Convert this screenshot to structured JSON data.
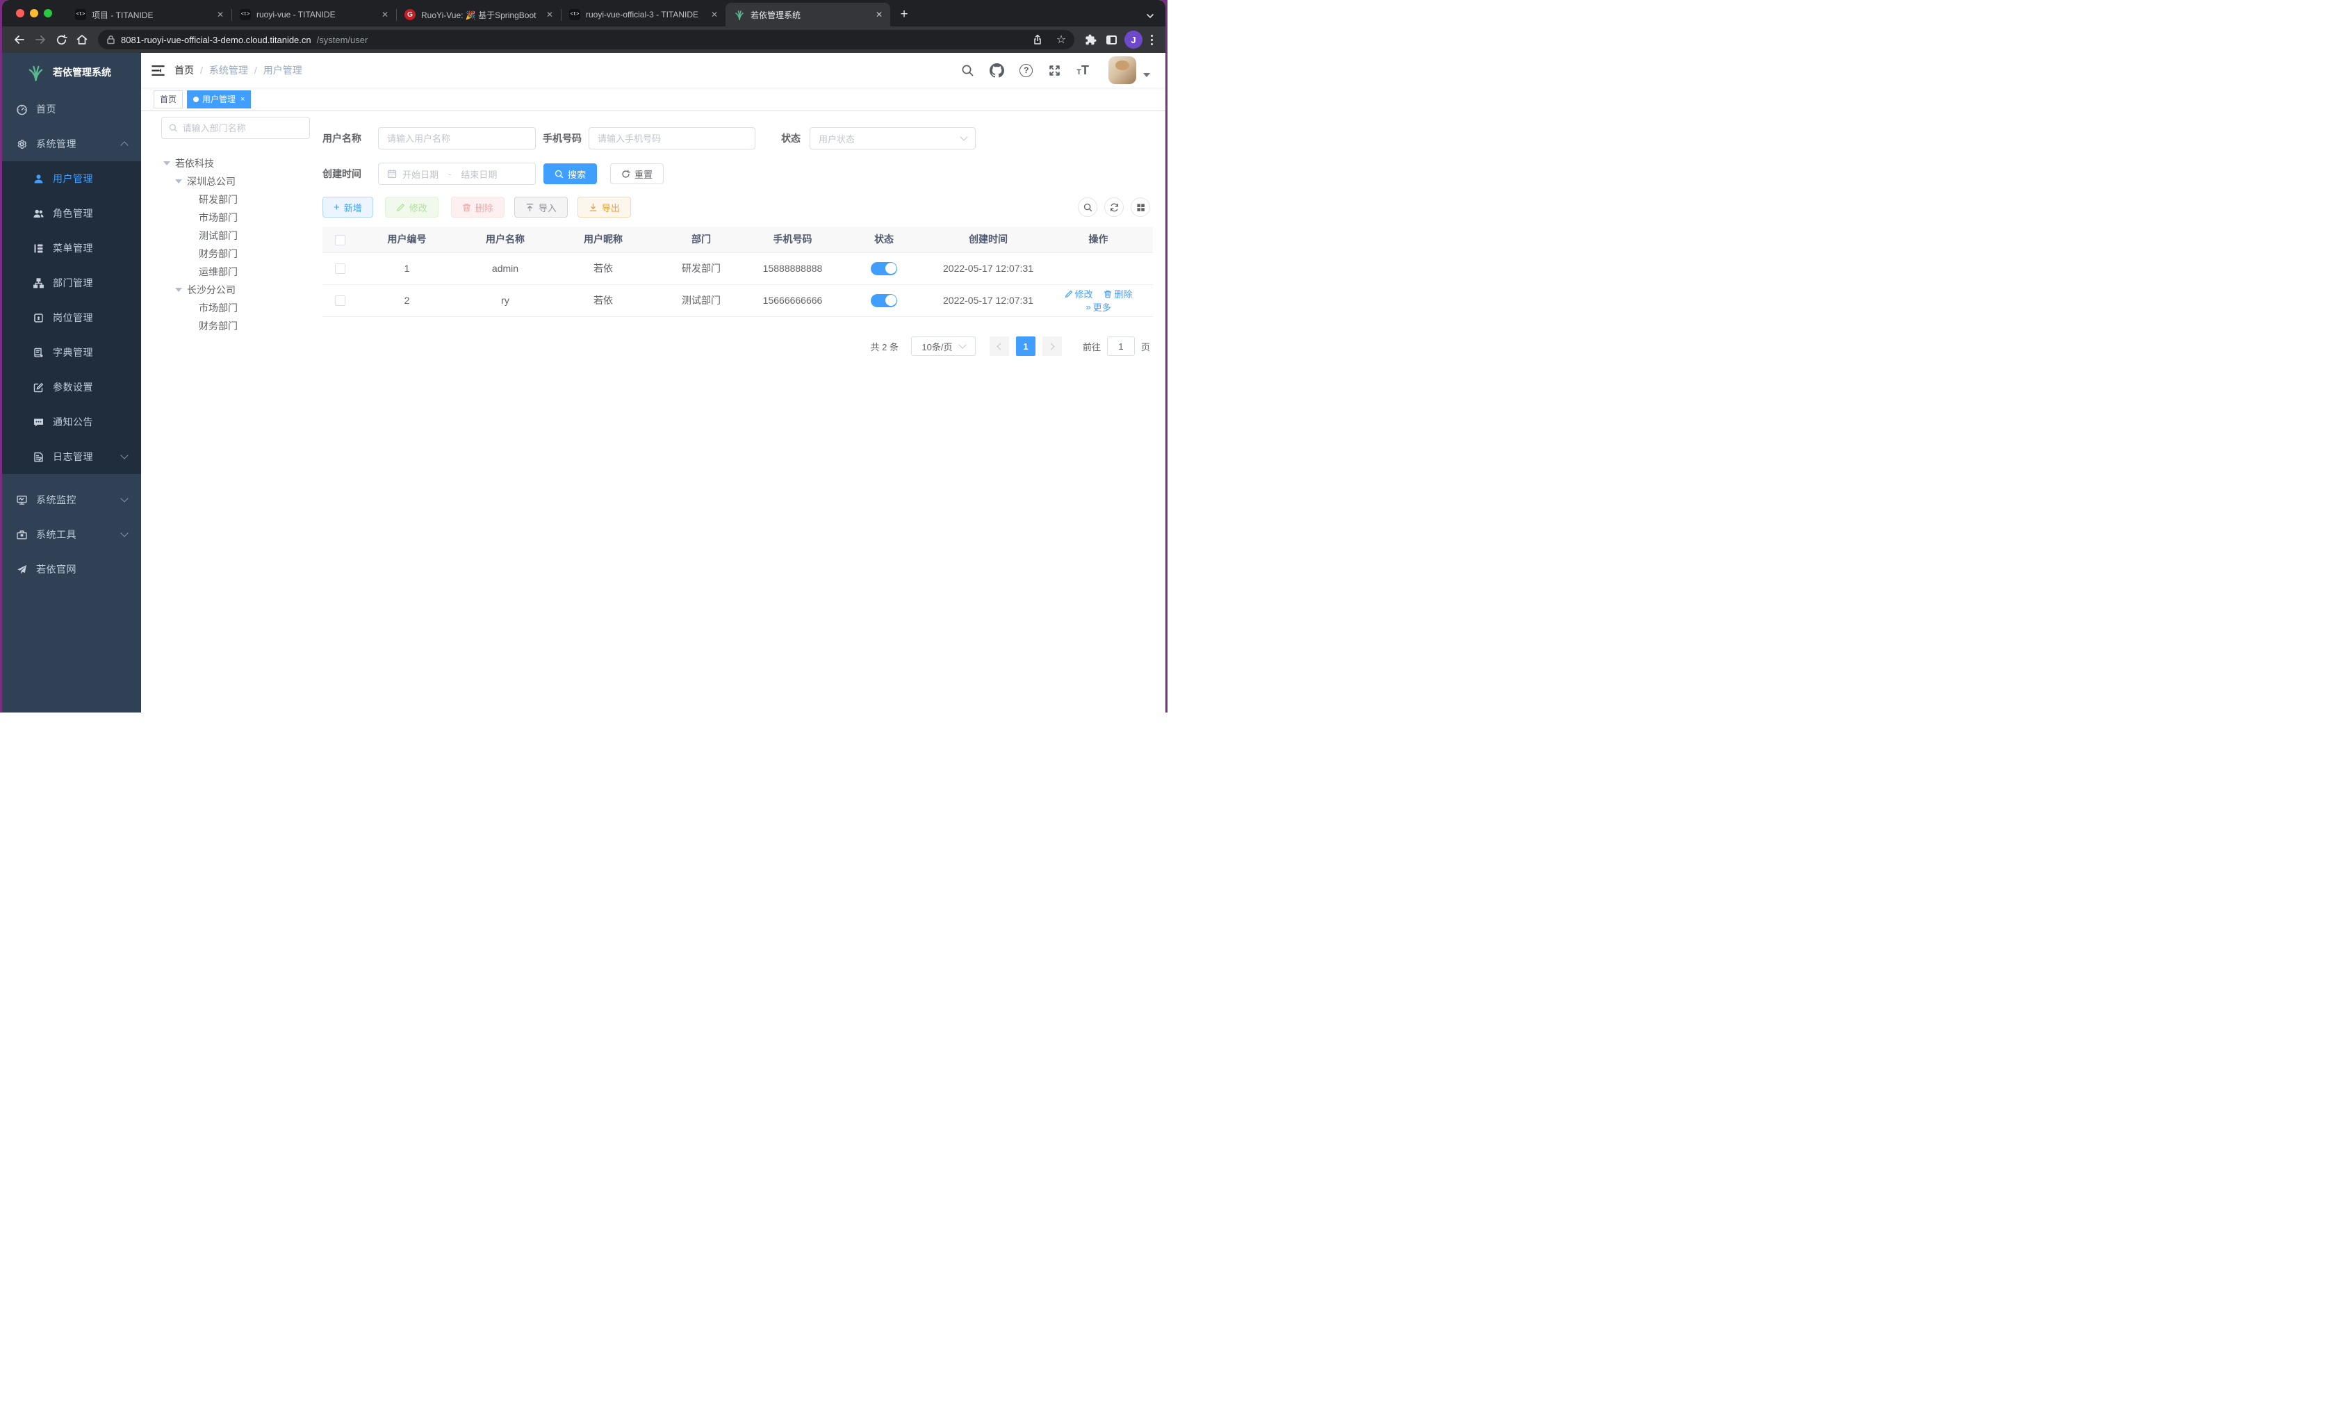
{
  "browser": {
    "tabs": [
      {
        "title": "项目 - TITANIDE"
      },
      {
        "title": "ruoyi-vue - TITANIDE"
      },
      {
        "title": "RuoYi-Vue: 🎉 基于SpringBoot"
      },
      {
        "title": "ruoyi-vue-official-3 - TITANIDE"
      },
      {
        "title": "若依管理系统"
      }
    ],
    "close_glyph": "✕",
    "new_tab_glyph": "+",
    "strip_caret": "⌄",
    "url_host": "8081-ruoyi-vue-official-3-demo.cloud.titanide.cn",
    "url_path": "/system/user",
    "profile_initial": "J",
    "gitee_initial": "G",
    "titanide_glyph": "<t>"
  },
  "app": {
    "logo_title": "若依管理系统",
    "menu": [
      {
        "label": "首页"
      },
      {
        "label": "系统管理"
      },
      {
        "label": "用户管理"
      },
      {
        "label": "角色管理"
      },
      {
        "label": "菜单管理"
      },
      {
        "label": "部门管理"
      },
      {
        "label": "岗位管理"
      },
      {
        "label": "字典管理"
      },
      {
        "label": "参数设置"
      },
      {
        "label": "通知公告"
      },
      {
        "label": "日志管理"
      },
      {
        "label": "系统监控"
      },
      {
        "label": "系统工具"
      },
      {
        "label": "若依官网"
      }
    ],
    "breadcrumb": [
      "首页",
      "系统管理",
      "用户管理"
    ],
    "breadcrumb_sep": "/",
    "tags": [
      {
        "label": "首页"
      },
      {
        "label": "用户管理"
      }
    ],
    "tag_close": "×"
  },
  "filters": {
    "dept_search_placeholder": "请输入部门名称",
    "username_label": "用户名称",
    "username_placeholder": "请输入用户名称",
    "phone_label": "手机号码",
    "phone_placeholder": "请输入手机号码",
    "status_label": "状态",
    "status_placeholder": "用户状态",
    "date_label": "创建时间",
    "date_start_placeholder": "开始日期",
    "date_separator": "-",
    "date_end_placeholder": "结束日期",
    "search_button": "搜索",
    "reset_button": "重置"
  },
  "tree": [
    {
      "label": "若依科技"
    },
    {
      "label": "深圳总公司"
    },
    {
      "label": "研发部门"
    },
    {
      "label": "市场部门"
    },
    {
      "label": "测试部门"
    },
    {
      "label": "财务部门"
    },
    {
      "label": "运维部门"
    },
    {
      "label": "长沙分公司"
    },
    {
      "label": "市场部门"
    },
    {
      "label": "财务部门"
    }
  ],
  "toolbar": {
    "add": "新增",
    "edit": "修改",
    "delete": "删除",
    "import": "导入",
    "export": "导出"
  },
  "table": {
    "headers": [
      "用户编号",
      "用户名称",
      "用户昵称",
      "部门",
      "手机号码",
      "状态",
      "创建时间",
      "操作"
    ],
    "rows": [
      {
        "id": "1",
        "name": "admin",
        "nick": "若依",
        "dept": "研发部门",
        "phone": "15888888888",
        "created": "2022-05-17 12:07:31",
        "ops": []
      },
      {
        "id": "2",
        "name": "ry",
        "nick": "若依",
        "dept": "测试部门",
        "phone": "15666666666",
        "created": "2022-05-17 12:07:31",
        "ops": [
          "修改",
          "删除",
          "更多"
        ]
      }
    ]
  },
  "pagination": {
    "total": "共 2 条",
    "page_size": "10条/页",
    "page": "1",
    "jump_prefix": "前往",
    "jump_value": "1",
    "jump_suffix": "页"
  },
  "colors": {
    "accent": "#409eff",
    "sidebar_bg": "#304156",
    "submenu_bg": "#1f2d3d",
    "switch_on": "#409eff",
    "tag_active": "#409eff",
    "logo_green": "#5cb88f"
  }
}
